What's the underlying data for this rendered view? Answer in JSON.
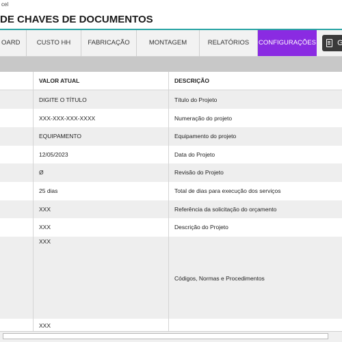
{
  "window": {
    "title_fragment": "cel"
  },
  "page": {
    "title": "DE CHAVES DE DOCUMENTOS"
  },
  "nav": {
    "tabs": [
      {
        "label": "OARD"
      },
      {
        "label": "CUSTO HH"
      },
      {
        "label": "FABRICAÇÃO"
      },
      {
        "label": "MONTAGEM"
      },
      {
        "label": "RELATÓRIOS"
      },
      {
        "label": "CONFIGURAÇÕES",
        "active": true
      }
    ],
    "extra_button": {
      "label": "G",
      "icon": "document-icon"
    }
  },
  "colors": {
    "accent": "#8a2be2",
    "header_underline": "#27a3a3",
    "band": "#c8c8c8",
    "row_alt": "#eeeeee"
  },
  "table": {
    "headers": {
      "value": "VALOR ATUAL",
      "description": "DESCRIÇÃO"
    },
    "rows": [
      {
        "value": "DIGITE O TÍTULO",
        "description": "Título do Projeto"
      },
      {
        "value": "XXX-XXX-XXX-XXXX",
        "description": "Numeração do projeto"
      },
      {
        "value": "EQUIPAMENTO",
        "description": "Equipamento do projeto"
      },
      {
        "value": "12/05/2023",
        "description": "Data do Projeto"
      },
      {
        "value": "Ø",
        "description": "Revisão do Projeto"
      },
      {
        "value": "25 dias",
        "description": "Total de dias para execução dos serviços"
      },
      {
        "value": "XXX",
        "description": "Referência da solicitação do orçamento"
      },
      {
        "value": "XXX",
        "description": "Descrição do Projeto"
      },
      {
        "value": "XXX",
        "description": "Códigos, Normas e Procedimentos"
      },
      {
        "value": "XXX",
        "description": ""
      }
    ]
  }
}
